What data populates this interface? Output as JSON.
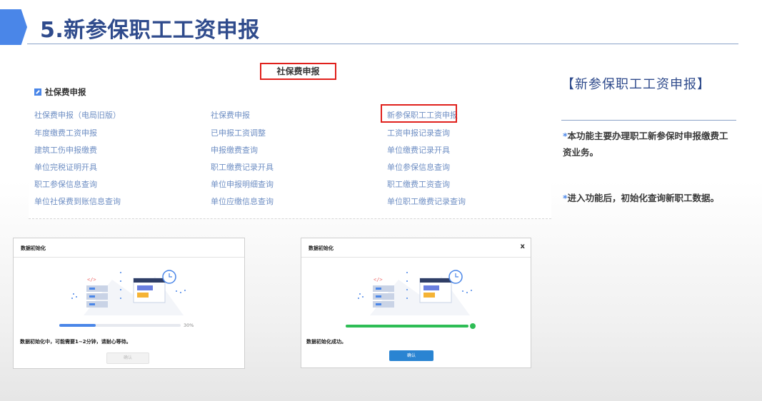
{
  "slide": {
    "title": "5.新参保职工工资申报",
    "accent_color": "#4a86e8",
    "title_color": "#2f4b8c"
  },
  "menu": {
    "header": "社保费申报",
    "section_title": "社保费申报",
    "columns": [
      [
        "社保费申报（电局旧版）",
        "年度缴费工资申报",
        "建筑工伤申报缴费",
        "单位完税证明开具",
        "职工参保信息查询",
        "单位社保费到账信息查询"
      ],
      [
        "社保费申报",
        "已申报工资调整",
        "申报缴费查询",
        "职工缴费记录开具",
        "单位申报明细查询",
        "单位应缴信息查询"
      ],
      [
        "新参保职工工资申报",
        "工资申报记录查询",
        "单位缴费记录开具",
        "单位参保信息查询",
        "职工缴费工资查询",
        "单位职工缴费记录查询"
      ]
    ],
    "highlighted_item": "新参保职工工资申报",
    "link_color": "#6f8fc4",
    "highlight_color": "#e0201c"
  },
  "description": {
    "title": "【新参保职工工资申报】",
    "points": [
      {
        "star": "*",
        "text": "本功能主要办理职工新参保时申报缴费工资业务。"
      },
      {
        "star": "*",
        "text": "进入功能后，初始化查询新职工数据。"
      }
    ]
  },
  "dialog_loading": {
    "title": "数据初始化",
    "progress": 0.3,
    "progress_label": "30%",
    "status": "数据初始化中，可能需要1~2分钟，请耐心等待。",
    "button": "确认",
    "progress_color": "#4a86e8"
  },
  "dialog_success": {
    "title": "数据初始化",
    "close": "x",
    "progress": 1.0,
    "status": "数据初始化成功。",
    "button": "确认",
    "progress_color": "#2ebd55",
    "button_color": "#2a84d2"
  }
}
